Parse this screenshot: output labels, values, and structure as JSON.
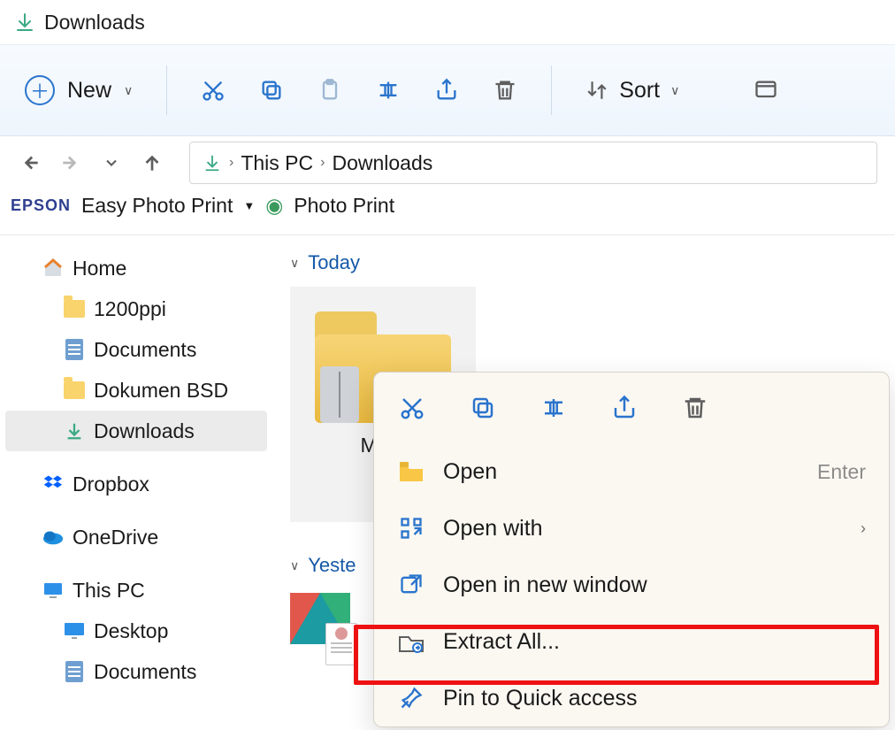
{
  "window": {
    "title": "Downloads"
  },
  "toolbar": {
    "new_label": "New",
    "sort_label": "Sort"
  },
  "breadcrumb": {
    "root": "This PC",
    "current": "Downloads"
  },
  "epson": {
    "brand": "EPSON",
    "easy_label": "Easy Photo Print",
    "photo_label": "Photo Print"
  },
  "sidebar": {
    "home": "Home",
    "item1": "1200ppi",
    "item2": "Documents",
    "item3": "Dokumen BSD",
    "item4": "Downloads",
    "dropbox": "Dropbox",
    "onedrive": "OneDrive",
    "thispc": "This PC",
    "desktop": "Desktop",
    "documents2": "Documents"
  },
  "content": {
    "group_today": "Today",
    "zip_label": "MCV",
    "group_yesterday": "Yeste"
  },
  "context": {
    "open": "Open",
    "open_hint": "Enter",
    "open_with": "Open with",
    "open_new_window": "Open in new window",
    "extract_all": "Extract All...",
    "pin_quick": "Pin to Quick access"
  }
}
